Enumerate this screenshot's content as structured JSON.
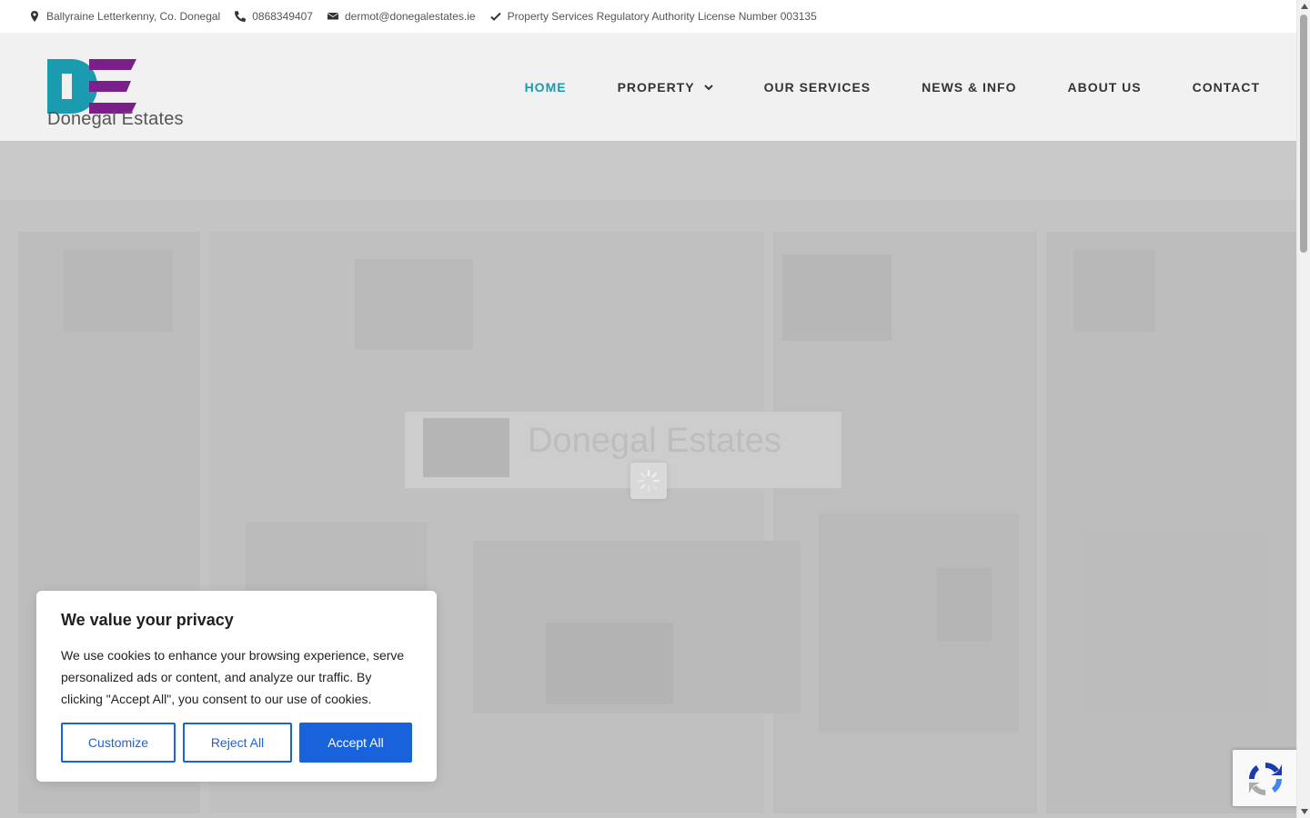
{
  "topbar": {
    "address": "Ballyraine Letterkenny, Co. Donegal",
    "phone": "0868349407",
    "email": "dermot@donegalestates.ie",
    "license": "Property Services Regulatory Authority License Number 003135"
  },
  "brand": {
    "logo_letters": "DE",
    "name": "Donegal Estates",
    "teal": "#1a9bb0",
    "purple": "#7b1f8a"
  },
  "nav": {
    "items": [
      {
        "label": "HOME"
      },
      {
        "label": "PROPERTY"
      },
      {
        "label": "OUR SERVICES"
      },
      {
        "label": "NEWS & INFO"
      },
      {
        "label": "ABOUT US"
      },
      {
        "label": "CONTACT"
      }
    ],
    "active_color": "#1a9bb0"
  },
  "hero": {
    "sign_text": "Donegal Estates",
    "loading": true
  },
  "cookie": {
    "title": "We value your privacy",
    "body": "We use cookies to enhance your browsing experience, serve personalized ads or content, and analyze our traffic. By clicking \"Accept All\", you consent to our use of cookies.",
    "customize_label": "Customize",
    "reject_label": "Reject All",
    "accept_label": "Accept All",
    "accent": "#1863dc"
  },
  "icons": {
    "address": "map-pin-icon",
    "phone": "phone-icon",
    "email": "envelope-icon",
    "license": "check-icon",
    "property_dropdown": "chevron-down-icon",
    "loading": "spinner-icon",
    "captcha": "recaptcha-icon"
  }
}
